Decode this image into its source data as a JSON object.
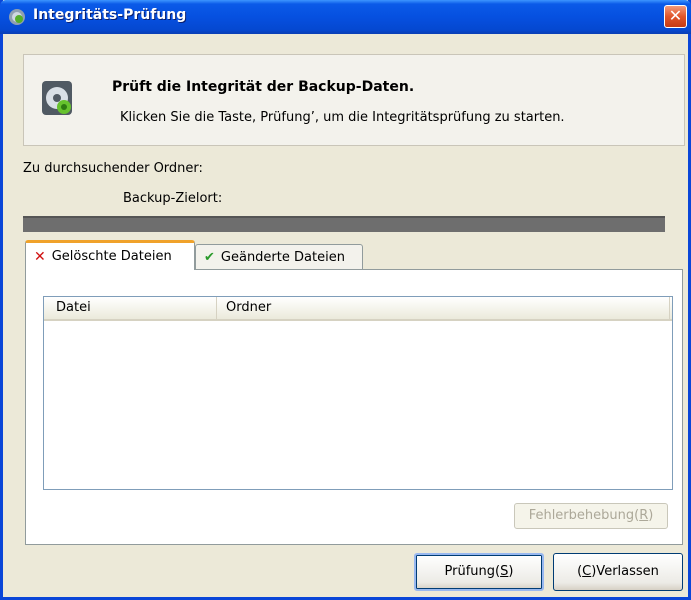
{
  "window": {
    "title": "Integritäts-Prüfung",
    "close_symbol": "✕"
  },
  "header": {
    "title": "Prüft die Integrität der Backup-Daten.",
    "description": "Klicken Sie die Taste, Prüfung’, um die Integritätsprüfung zu starten.",
    "icon": "backup-disk-icon"
  },
  "labels": {
    "folder": "Zu durchsuchender Ordner:",
    "target": "Backup-Zielort:"
  },
  "progress": {
    "value": 1.0
  },
  "tabs": [
    {
      "label": "Gelöschte Dateien",
      "icon": "x-icon",
      "symbol": "✕",
      "active": true
    },
    {
      "label": "Geänderte Dateien",
      "icon": "check-icon",
      "symbol": "✔",
      "active": false
    }
  ],
  "table": {
    "columns": [
      "Datei",
      "Ordner"
    ],
    "rows": []
  },
  "buttons": {
    "fix_label": "Fehlerbehebung(",
    "fix_key": "R",
    "fix_end": ")",
    "check_label": "Prüfung(",
    "check_key": "S",
    "check_end": ")",
    "exit_open": "(",
    "exit_key": "C",
    "exit_label": ")Verlassen"
  },
  "colors": {
    "titlebar": "#0650e0",
    "active_tab_accent": "#f0a22a",
    "dialog_bg": "#ece9d8"
  }
}
